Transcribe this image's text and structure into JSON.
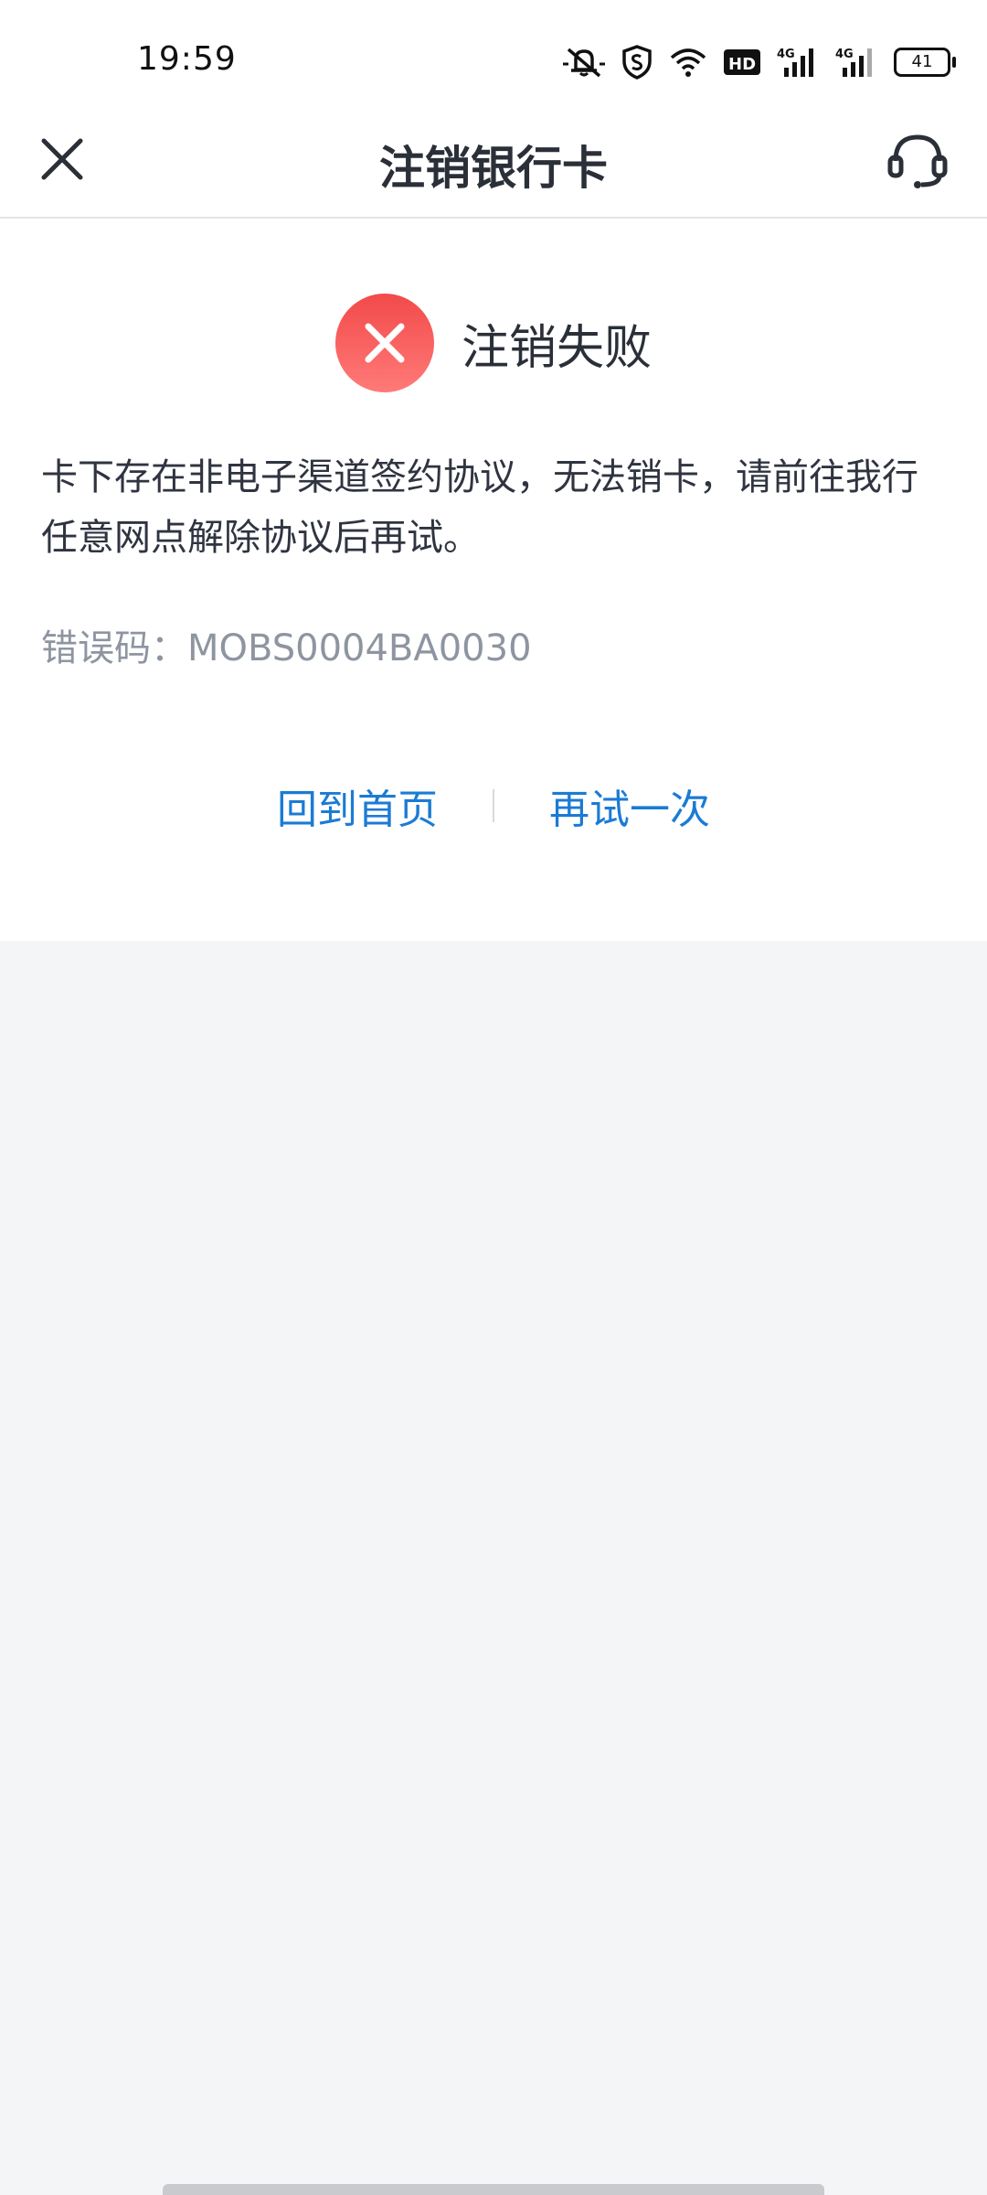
{
  "status_bar": {
    "time": "19:59",
    "battery": "41",
    "icons": [
      "bell-muted-icon",
      "shield-icon",
      "wifi-icon",
      "hd-icon",
      "signal-4g-icon",
      "signal-4g-icon",
      "battery-icon"
    ],
    "hd_label": "HD",
    "net1": "4G",
    "net2": "4G"
  },
  "navbar": {
    "title": "注销银行卡",
    "left_icon": "close-icon",
    "right_icon": "customer-service-icon"
  },
  "result": {
    "status_icon": "fail-icon",
    "title": "注销失败",
    "message": "卡下存在非电子渠道签约协议，无法销卡，请前往我行任意网点解除协议后再试。",
    "error_code": "错误码：MOBS0004BA0030"
  },
  "actions": {
    "home_label": "回到首页",
    "retry_label": "再试一次"
  },
  "colors": {
    "accent": "#1b7bd4",
    "error": "#f24a4a",
    "background": "#f4f5f7"
  }
}
